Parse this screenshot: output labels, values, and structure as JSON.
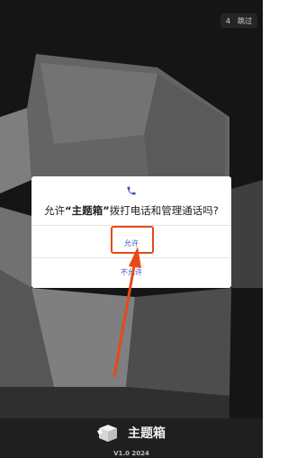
{
  "skip": {
    "countdown": "4",
    "label": "跳过"
  },
  "dialog": {
    "icon": "phone-icon",
    "message_prefix": "允许",
    "app_name": "“主题箱”",
    "message_suffix": "拨打电话和管理通话吗?",
    "allow_label": "允许",
    "deny_label": "不允许"
  },
  "brand": {
    "logo": "box-logo-icon",
    "name": "主题箱",
    "version": "V1.0 2024"
  },
  "annotation": {
    "color": "#e64a19"
  }
}
